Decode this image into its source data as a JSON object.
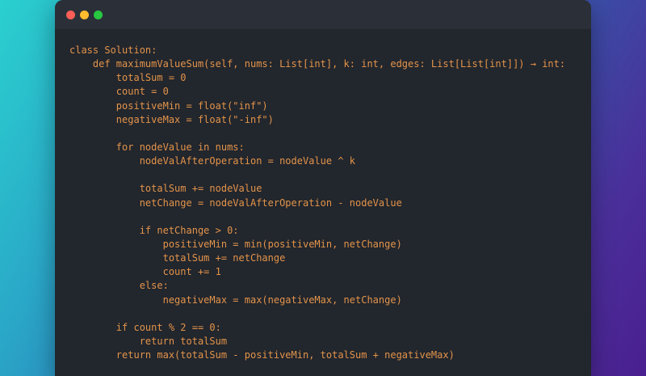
{
  "window": {
    "controls": {
      "close": "close-dot",
      "minimize": "minimize-dot",
      "maximize": "maximize-dot"
    },
    "colors": {
      "close": "#ff5f57",
      "minimize": "#febc2e",
      "maximize": "#28c840",
      "code_text": "#e3944a",
      "editor_bg": "#22262d"
    }
  },
  "code": {
    "lines": [
      "class Solution:",
      "    def maximumValueSum(self, nums: List[int], k: int, edges: List[List[int]]) → int:",
      "        totalSum = 0",
      "        count = 0",
      "        positiveMin = float(\"inf\")",
      "        negativeMax = float(\"-inf\")",
      "",
      "        for nodeValue in nums:",
      "            nodeValAfterOperation = nodeValue ^ k",
      "",
      "            totalSum += nodeValue",
      "            netChange = nodeValAfterOperation - nodeValue",
      "",
      "            if netChange > 0:",
      "                positiveMin = min(positiveMin, netChange)",
      "                totalSum += netChange",
      "                count += 1",
      "            else:",
      "                negativeMax = max(negativeMax, netChange)",
      "",
      "        if count % 2 == 0:",
      "            return totalSum",
      "        return max(totalSum - positiveMin, totalSum + negativeMax)"
    ]
  }
}
